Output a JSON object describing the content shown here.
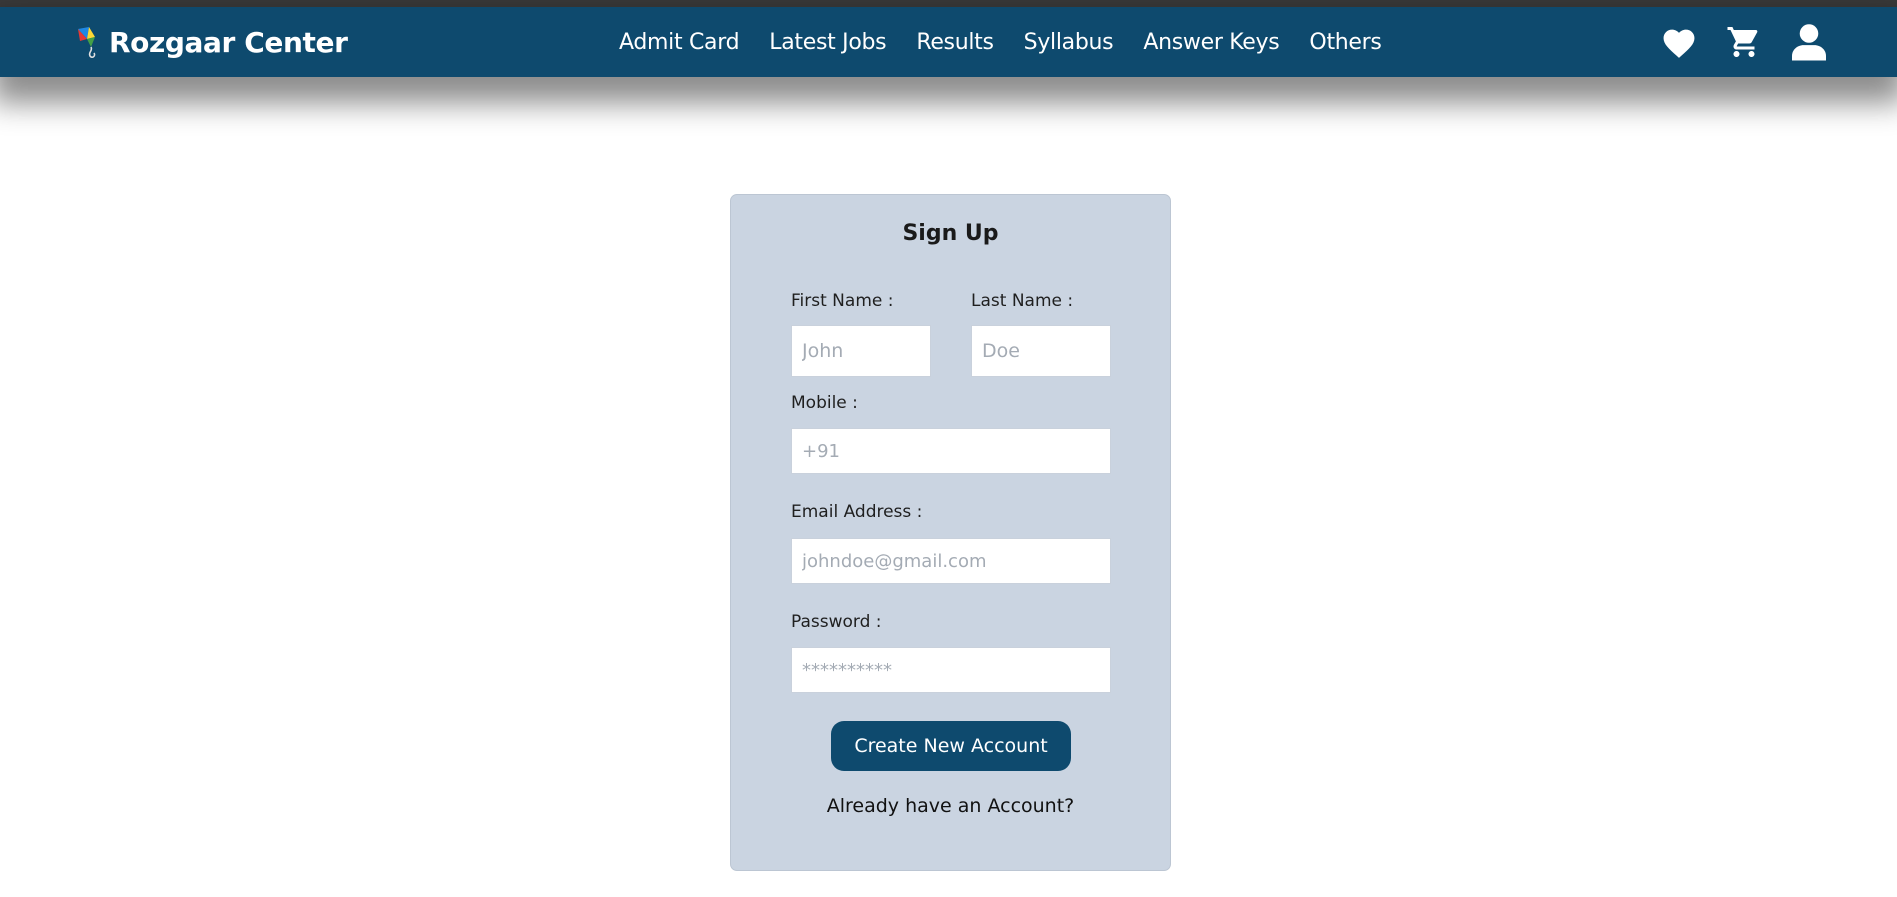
{
  "brand": {
    "name": "Rozgaar Center"
  },
  "nav": {
    "links": [
      "Admit Card",
      "Latest Jobs",
      "Results",
      "Syllabus",
      "Answer Keys",
      "Others"
    ],
    "icons": [
      "heart-icon",
      "cart-icon",
      "user-icon"
    ]
  },
  "signup": {
    "title": "Sign Up",
    "first_name": {
      "label": "First Name :",
      "placeholder": "John"
    },
    "last_name": {
      "label": "Last Name :",
      "placeholder": "Doe"
    },
    "mobile": {
      "label": "Mobile :",
      "placeholder": "+91"
    },
    "email": {
      "label": "Email Address :",
      "placeholder": "johndoe@gmail.com"
    },
    "password": {
      "label": "Password :",
      "placeholder": "**********"
    },
    "submit_label": "Create New Account",
    "login_prompt": "Already have an Account?"
  },
  "colors": {
    "navbar": "#0e4a6e",
    "card": "#cad4e1",
    "button": "#0e4a6e"
  }
}
